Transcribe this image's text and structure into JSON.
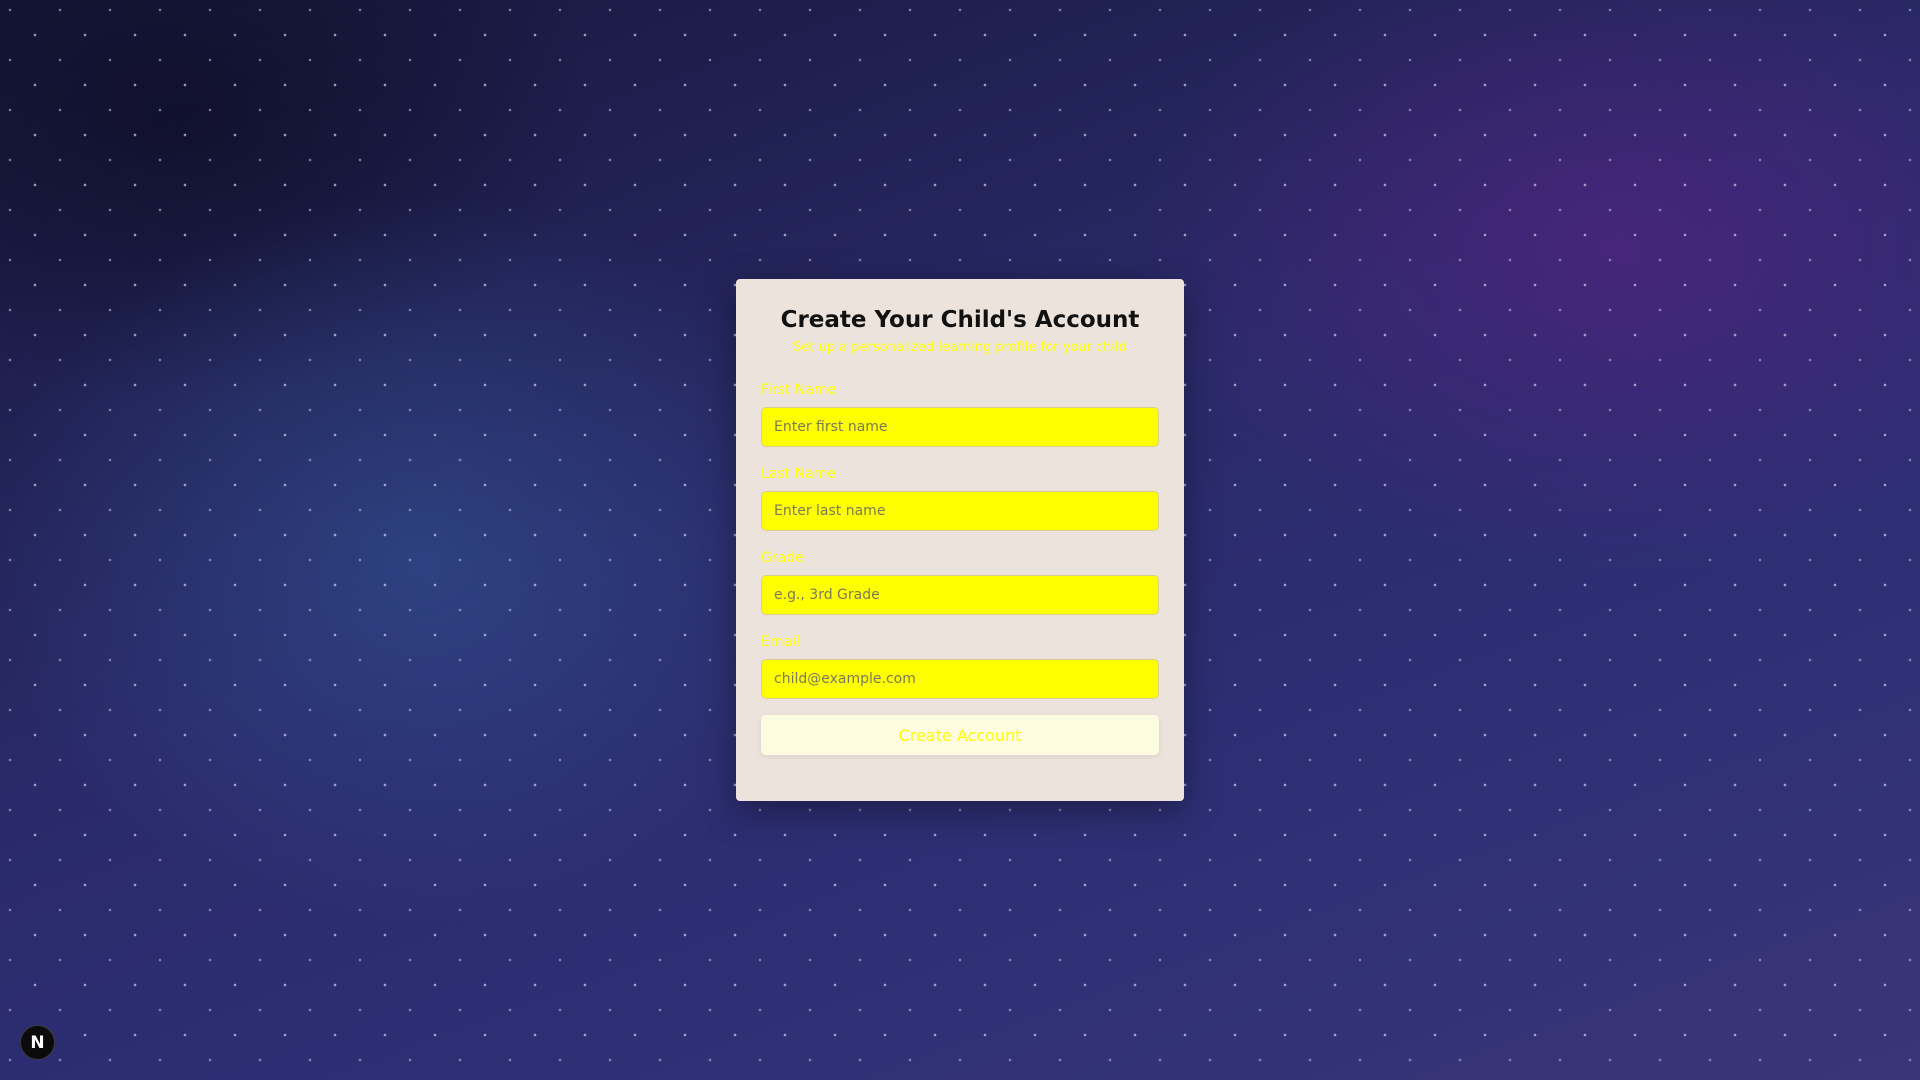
{
  "form": {
    "title": "Create Your Child's Account",
    "subtitle": "Set up a personalized learning profile for your child",
    "fields": [
      {
        "label": "First Name",
        "placeholder": "Enter first name",
        "value": ""
      },
      {
        "label": "Last Name",
        "placeholder": "Enter last name",
        "value": ""
      },
      {
        "label": "Grade",
        "placeholder": "e.g., 3rd Grade",
        "value": ""
      },
      {
        "label": "Email",
        "placeholder": "child@example.com",
        "value": ""
      }
    ],
    "submit_label": "Create Account"
  },
  "dev_badge": {
    "letter": "N"
  },
  "colors": {
    "card_background": "#ece4dc",
    "input_background": "#ffff00",
    "label_text": "#ffff00",
    "button_background": "#fdfce0"
  }
}
